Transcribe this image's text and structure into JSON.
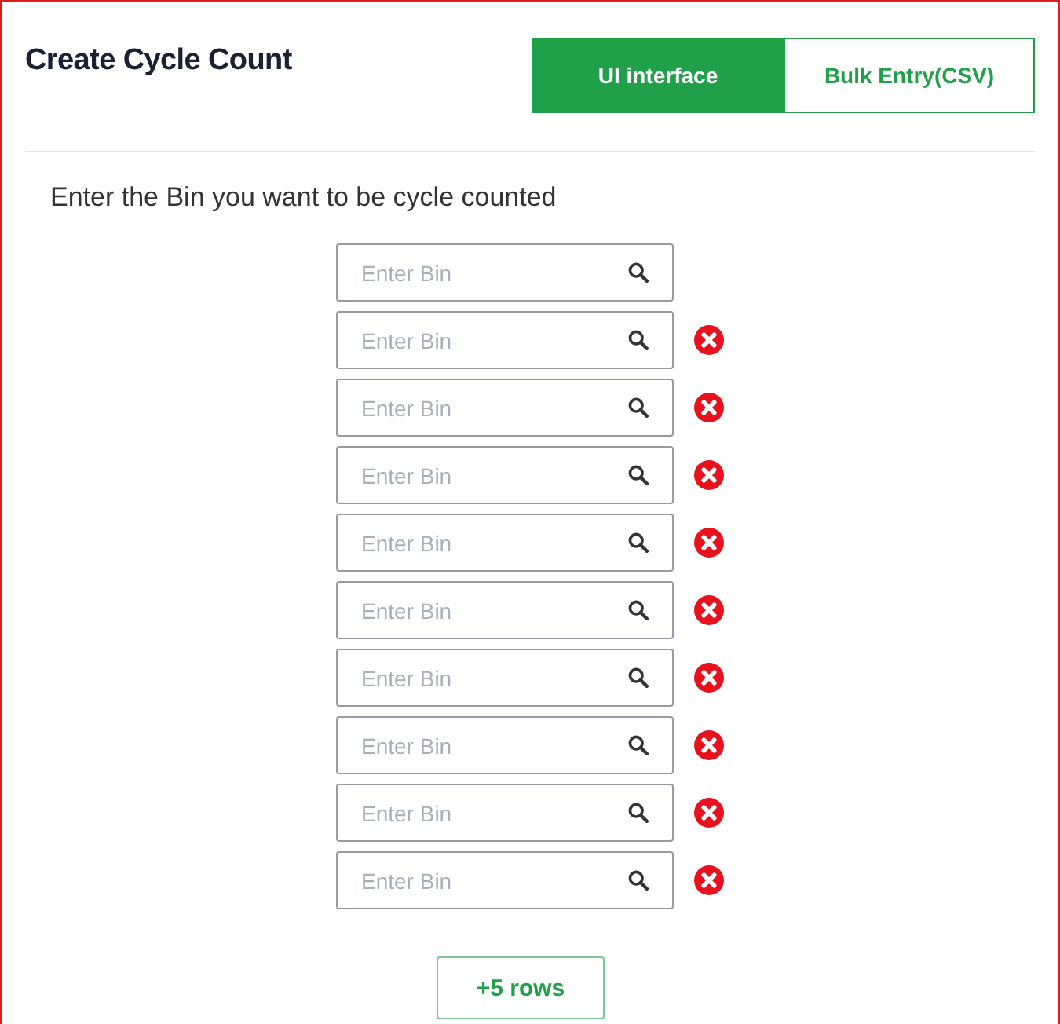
{
  "title": "Create Cycle Count",
  "tabs": [
    {
      "label": "UI interface",
      "selected": true
    },
    {
      "label": "Bulk Entry(CSV)",
      "selected": false
    }
  ],
  "prompt": "Enter the Bin you want to be cycle counted",
  "bins": [
    {
      "placeholder": "Enter Bin",
      "removable": false
    },
    {
      "placeholder": "Enter Bin",
      "removable": true
    },
    {
      "placeholder": "Enter Bin",
      "removable": true
    },
    {
      "placeholder": "Enter Bin",
      "removable": true
    },
    {
      "placeholder": "Enter Bin",
      "removable": true
    },
    {
      "placeholder": "Enter Bin",
      "removable": true
    },
    {
      "placeholder": "Enter Bin",
      "removable": true
    },
    {
      "placeholder": "Enter Bin",
      "removable": true
    },
    {
      "placeholder": "Enter Bin",
      "removable": true
    },
    {
      "placeholder": "Enter Bin",
      "removable": true
    }
  ],
  "add_button": "+5 rows"
}
